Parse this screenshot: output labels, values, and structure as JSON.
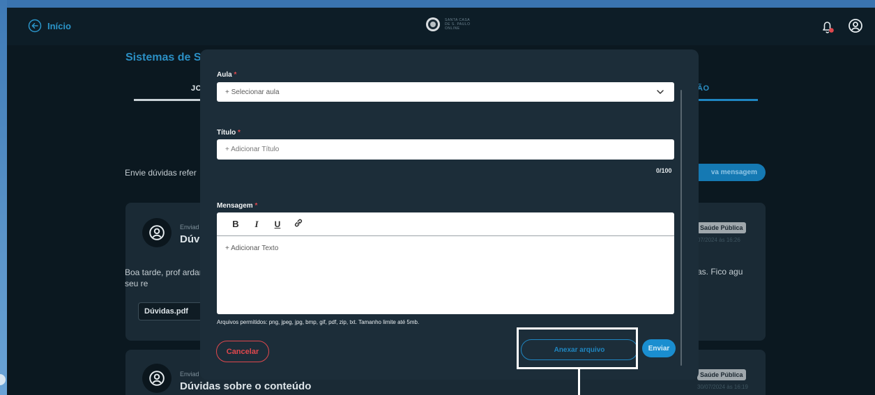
{
  "topbar": {
    "back_label": "Início",
    "logo_text": "SANTA CASA DE S. PAULO ONLINE"
  },
  "background": {
    "page_title": "Sistemas de S",
    "tab_left": "JO",
    "tab_right": "ÃO",
    "intro": "Envie dúvidas refer",
    "new_message_label": "va mensagem",
    "card1": {
      "sent_label": "Enviad",
      "title": "Dúv",
      "badge": "Saúde Pública",
      "date": "07/2024 às 16:26",
      "body_left": "Boa tarde, prof ardando seu re",
      "body_right": "as. Fico agu",
      "attachment": "Dúvidas.pdf"
    },
    "card2": {
      "sent_label": "Enviad",
      "title": "Dúvidas sobre o conteúdo",
      "badge": "Saúde Pública",
      "date": "30/07/2024 às 16:19"
    }
  },
  "modal": {
    "aula_label": "Aula",
    "aula_placeholder": "+ Selecionar aula",
    "titulo_label": "Título",
    "titulo_placeholder": "+ Adicionar Título",
    "counter": "0/100",
    "mensagem_label": "Mensagem",
    "required_mark": "*",
    "toolbar": {
      "bold": "B",
      "italic": "I",
      "underline": "U"
    },
    "message_placeholder": "+ Adicionar Texto",
    "allowed_files": "Arquivos permitidos: png, jpeg, jpg, bmp, gif, pdf, zip, txt. Tamanho limite até 5mb.",
    "cancel_label": "Cancelar",
    "attach_label": "Anexar arquivo",
    "send_label": "Enviar"
  },
  "colors": {
    "accent": "#1f86c1",
    "danger": "#e0484d",
    "modal_bg": "#1c2d39",
    "page_bg": "#0b1820"
  },
  "icons": [
    "back-arrow-icon",
    "logo-icon",
    "bell-icon",
    "user-icon",
    "chevron-down-icon",
    "link-icon"
  ]
}
